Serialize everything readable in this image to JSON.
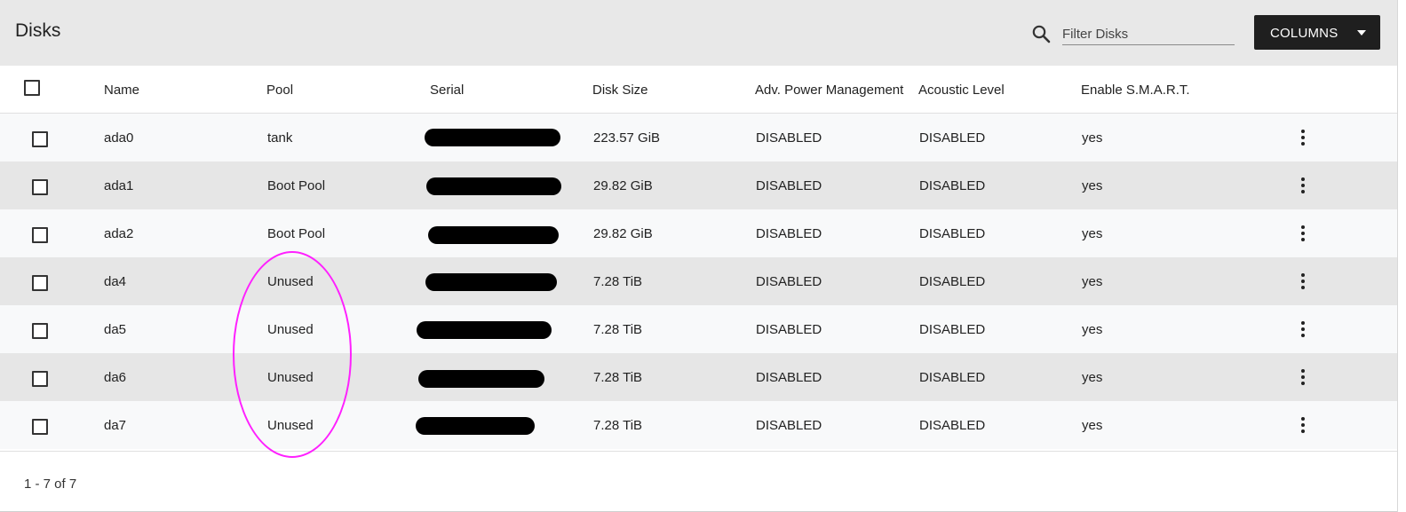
{
  "header": {
    "title": "Disks",
    "search_icon": "search-icon",
    "filter_placeholder": "Filter Disks",
    "columns_label": "COLUMNS"
  },
  "table": {
    "columns": [
      "Name",
      "Pool",
      "Serial",
      "Disk Size",
      "Adv. Power Management",
      "Acoustic Level",
      "Enable S.M.A.R.T."
    ],
    "rows": [
      {
        "name": "ada0",
        "pool": "tank",
        "serial": "",
        "size": "223.57 GiB",
        "apm": "DISABLED",
        "acoustic": "DISABLED",
        "smart": "yes"
      },
      {
        "name": "ada1",
        "pool": "Boot Pool",
        "serial": "",
        "size": "29.82 GiB",
        "apm": "DISABLED",
        "acoustic": "DISABLED",
        "smart": "yes"
      },
      {
        "name": "ada2",
        "pool": "Boot Pool",
        "serial": "",
        "size": "29.82 GiB",
        "apm": "DISABLED",
        "acoustic": "DISABLED",
        "smart": "yes"
      },
      {
        "name": "da4",
        "pool": "Unused",
        "serial": "",
        "size": "7.28 TiB",
        "apm": "DISABLED",
        "acoustic": "DISABLED",
        "smart": "yes"
      },
      {
        "name": "da5",
        "pool": "Unused",
        "serial": "",
        "size": "7.28 TiB",
        "apm": "DISABLED",
        "acoustic": "DISABLED",
        "smart": "yes"
      },
      {
        "name": "da6",
        "pool": "Unused",
        "serial": "",
        "size": "7.28 TiB",
        "apm": "DISABLED",
        "acoustic": "DISABLED",
        "smart": "yes"
      },
      {
        "name": "da7",
        "pool": "Unused",
        "serial": "",
        "size": "7.28 TiB",
        "apm": "DISABLED",
        "acoustic": "DISABLED",
        "smart": "yes"
      }
    ]
  },
  "footer": {
    "paginator": "1 - 7 of 7"
  },
  "colors": {
    "header_bg": "#e8e8e8",
    "button_bg": "#1f1f1f",
    "annotation": "#ff20ff"
  }
}
